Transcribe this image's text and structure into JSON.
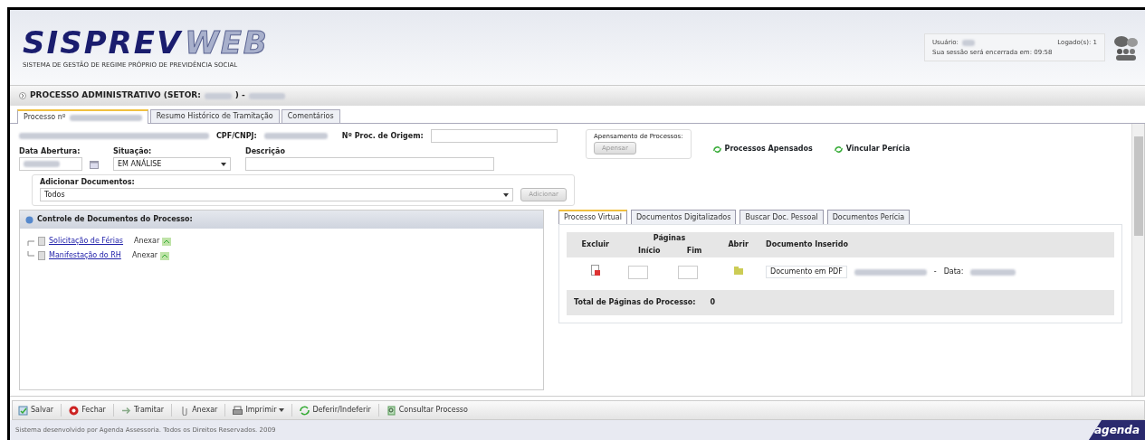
{
  "header": {
    "logo_main": "SISPREV",
    "logo_accent": "WEB",
    "logo_subtitle": "SISTEMA DE GESTÃO DE REGIME PRÓPRIO DE PREVIDÊNCIA SOCIAL",
    "session": {
      "user_label": "Usuário:",
      "logged_label": "Logado(s): 1",
      "expires": "Sua sessão será encerrada em: 09:58"
    }
  },
  "page_title": {
    "prefix": "PROCESSO ADMINISTRATIVO (SETOR:",
    "middle": ") -"
  },
  "tabs": [
    {
      "label": "Processo nº",
      "selected": true
    },
    {
      "label": "Resumo Histórico de Tramitação",
      "selected": false
    },
    {
      "label": "Comentários",
      "selected": false
    }
  ],
  "form": {
    "cpf_label": "CPF/CNPJ:",
    "origin_label": "Nº Proc. de Origem:",
    "date_label": "Data Abertura:",
    "status_label": "Situação:",
    "status_value": "EM ANÁLISE",
    "description_label": "Descrição",
    "attach_group": {
      "legend": "Apensamento de Processos:",
      "button": "Apensar",
      "disabled": true
    },
    "links": [
      "Processos Apensados",
      "Vincular Perícia"
    ],
    "add_documents": {
      "legend": "Adicionar Documentos:",
      "value": "Todos",
      "button": "Adicionar",
      "disabled": true
    }
  },
  "documents_panel": {
    "title": "Controle de Documentos do Processo:",
    "items": [
      {
        "label": "Solicitação de Férias",
        "action": "Anexar"
      },
      {
        "label": "Manifestação do RH",
        "action": "Anexar"
      }
    ]
  },
  "virtual_tabs": [
    {
      "label": "Processo Virtual",
      "selected": true
    },
    {
      "label": "Documentos Digitalizados",
      "selected": false
    },
    {
      "label": "Buscar Doc. Pessoal",
      "selected": false
    },
    {
      "label": "Documentos Perícia",
      "selected": false
    }
  ],
  "virtual_table": {
    "columns": [
      "Excluir",
      "Páginas",
      "Abrir",
      "Documento Inserido"
    ],
    "subcolumns": [
      "Início",
      "Fim"
    ],
    "rows": [
      {
        "document": "Documento em PDF",
        "separator": "-",
        "date_label": "Data:"
      }
    ],
    "total_label": "Total de Páginas do Processo:",
    "total_value": "0"
  },
  "toolbar": [
    {
      "label": "Salvar",
      "kind": "save"
    },
    {
      "label": "Fechar",
      "kind": "close"
    },
    {
      "label": "Tramitar",
      "kind": "forward"
    },
    {
      "label": "Anexar",
      "kind": "clip"
    },
    {
      "label": "Imprimir",
      "kind": "print",
      "dropdown": true
    },
    {
      "label": "Deferir/Indeferir",
      "kind": "cycle"
    },
    {
      "label": "Consultar Processo",
      "kind": "search"
    }
  ],
  "footer": {
    "text": "Sistema desenvolvido por Agenda Assessoria. Todos os Direitos Reservados. 2009",
    "logo": "agenda"
  }
}
